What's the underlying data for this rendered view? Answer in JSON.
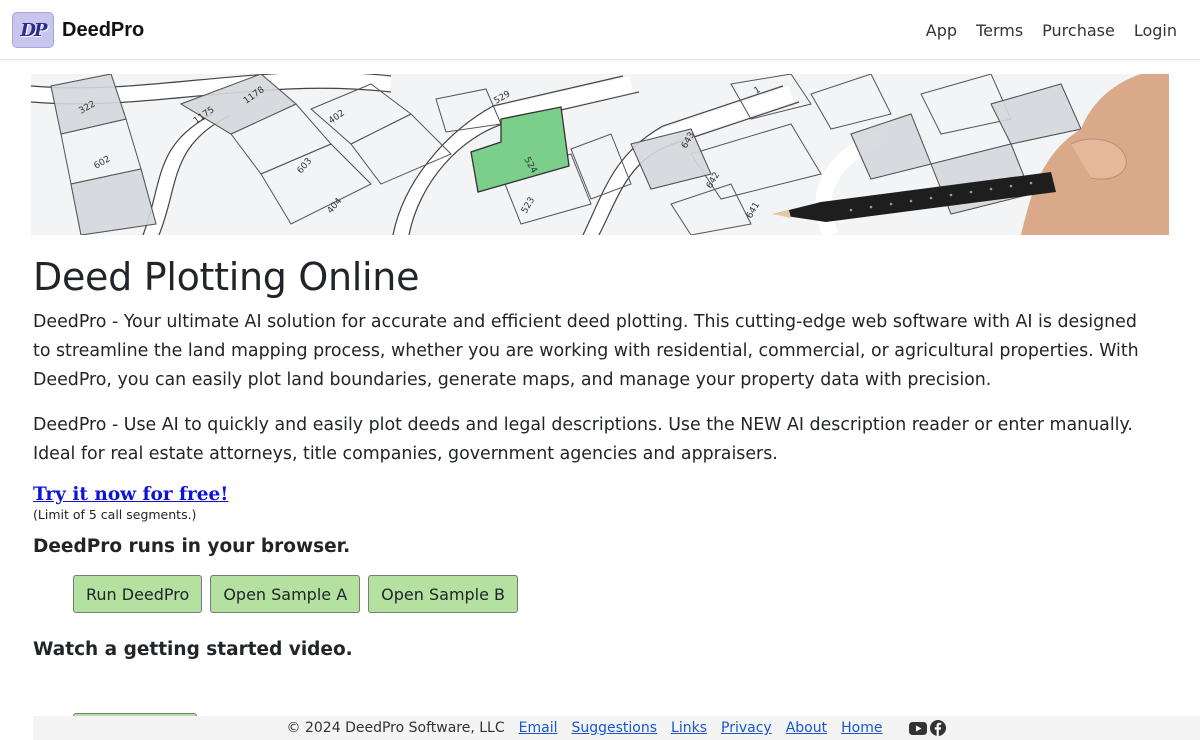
{
  "navbar": {
    "logo_text": "DP",
    "brand": "DeedPro",
    "links": [
      "App",
      "Terms",
      "Purchase",
      "Login"
    ]
  },
  "hero": {
    "lot_labels": [
      "322",
      "1178",
      "1175",
      "402",
      "529",
      "524",
      "643",
      "642",
      "641",
      "603",
      "404",
      "602",
      "523",
      "1"
    ]
  },
  "main": {
    "title": "Deed Plotting Online",
    "intro": "DeedPro - Your ultimate AI solution for accurate and efficient deed plotting. This cutting-edge web software with AI is designed to streamline the land mapping process, whether you are working with residential, commercial, or agricultural properties. With DeedPro, you can easily plot land boundaries, generate maps, and manage your property data with precision.",
    "description": "DeedPro - Use AI to quickly and easily plot deeds and legal descriptions. Use the NEW AI description reader or enter manually. Ideal for real estate attorneys, title companies, government agencies and appraisers.",
    "try_link": "Try it now for free!",
    "limit_note": "(Limit of 5 call segments.)",
    "browser_heading": "DeedPro runs in your browser.",
    "buttons": {
      "run": "Run DeedPro",
      "sample_a": "Open Sample A",
      "sample_b": "Open Sample B"
    },
    "video_heading": "Watch a getting started video."
  },
  "footer": {
    "copyright": "© 2024 DeedPro Software, LLC",
    "links": [
      "Email",
      "Suggestions",
      "Links",
      "Privacy",
      "About",
      "Home"
    ],
    "social_icons": [
      "youtube-icon",
      "facebook-icon"
    ]
  },
  "colors": {
    "button_bg": "#b4e0a0",
    "link": "#0d13d6",
    "highlight_lot": "#7ccf8a"
  }
}
